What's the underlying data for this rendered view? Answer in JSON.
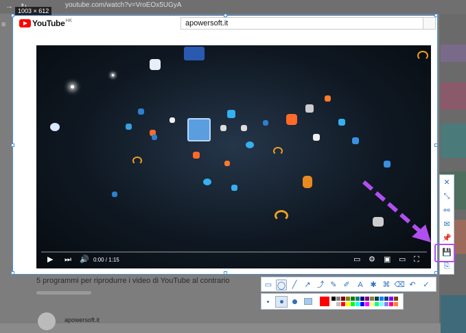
{
  "browser": {
    "url": "youtube.com/watch?v=VroEOx5UGyA"
  },
  "capture": {
    "size_label": "1003 × 612"
  },
  "youtube": {
    "region": "HK",
    "search_value": "apowersoft.it",
    "time": "0:00 / 1:15",
    "video_title": "5 programmi per riprodurre i video di YouTube al contrario",
    "channel": "apowersoft.it"
  },
  "side_toolbar": [
    "close-icon",
    "fit-icon",
    "share-icon",
    "email-icon",
    "pin-icon",
    "save-icon",
    "copy-icon"
  ],
  "bottom_toolbar": [
    "rectangle-tool",
    "ellipse-tool",
    "line-tool",
    "arrow-tool",
    "curve-arrow-tool",
    "pen-tool",
    "highlighter-tool",
    "text-tool",
    "blur-tool",
    "mosaic-tool",
    "eraser-tool",
    "undo-tool",
    "done-tool"
  ],
  "colors": {
    "accent": "#2e6fbf",
    "highlight": "#b04ff0",
    "selected_color": "#ff0000",
    "palette": [
      "#000000",
      "#808080",
      "#800000",
      "#808000",
      "#008000",
      "#008080",
      "#000080",
      "#800080",
      "#808040",
      "#004040",
      "#0080ff",
      "#004080",
      "#8000ff",
      "#804000",
      "#ffffff",
      "#c0c0c0",
      "#ff0000",
      "#ffff00",
      "#00ff00",
      "#00ffff",
      "#0000ff",
      "#ff00ff",
      "#ffff80",
      "#00ff80",
      "#80ffff",
      "#8080ff",
      "#ff0080",
      "#ff8040"
    ]
  }
}
